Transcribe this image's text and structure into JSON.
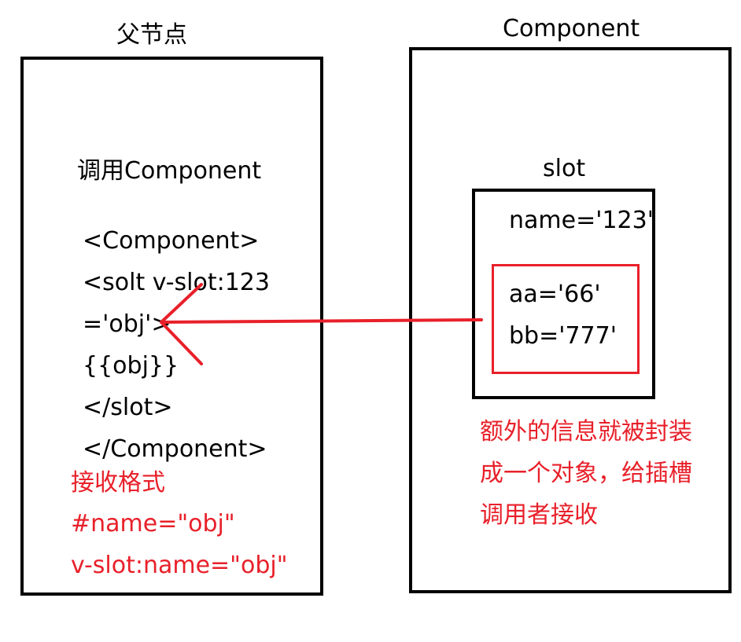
{
  "parent": {
    "title": "父节点",
    "heading": "调用Component",
    "code": [
      "<Component>",
      "<solt v-slot:123",
      "='obj'>",
      "{{obj}}",
      "</slot>",
      "</Component>"
    ],
    "receive": [
      "接收格式",
      "#name=\"obj\"",
      "v-slot:name=\"obj\""
    ]
  },
  "component": {
    "title": "Component",
    "slot_label": "slot",
    "name_attr": "name='123'",
    "extra": [
      "aa='66'",
      "bb='777'"
    ],
    "note": [
      "额外的信息就被封装",
      "成一个对象，给插槽",
      "调用者接收"
    ]
  },
  "colors": {
    "accent": "#e8202a",
    "border": "#000000"
  },
  "arrow": {
    "from": "component.extra",
    "to": "parent.code",
    "color": "#e8202a"
  }
}
